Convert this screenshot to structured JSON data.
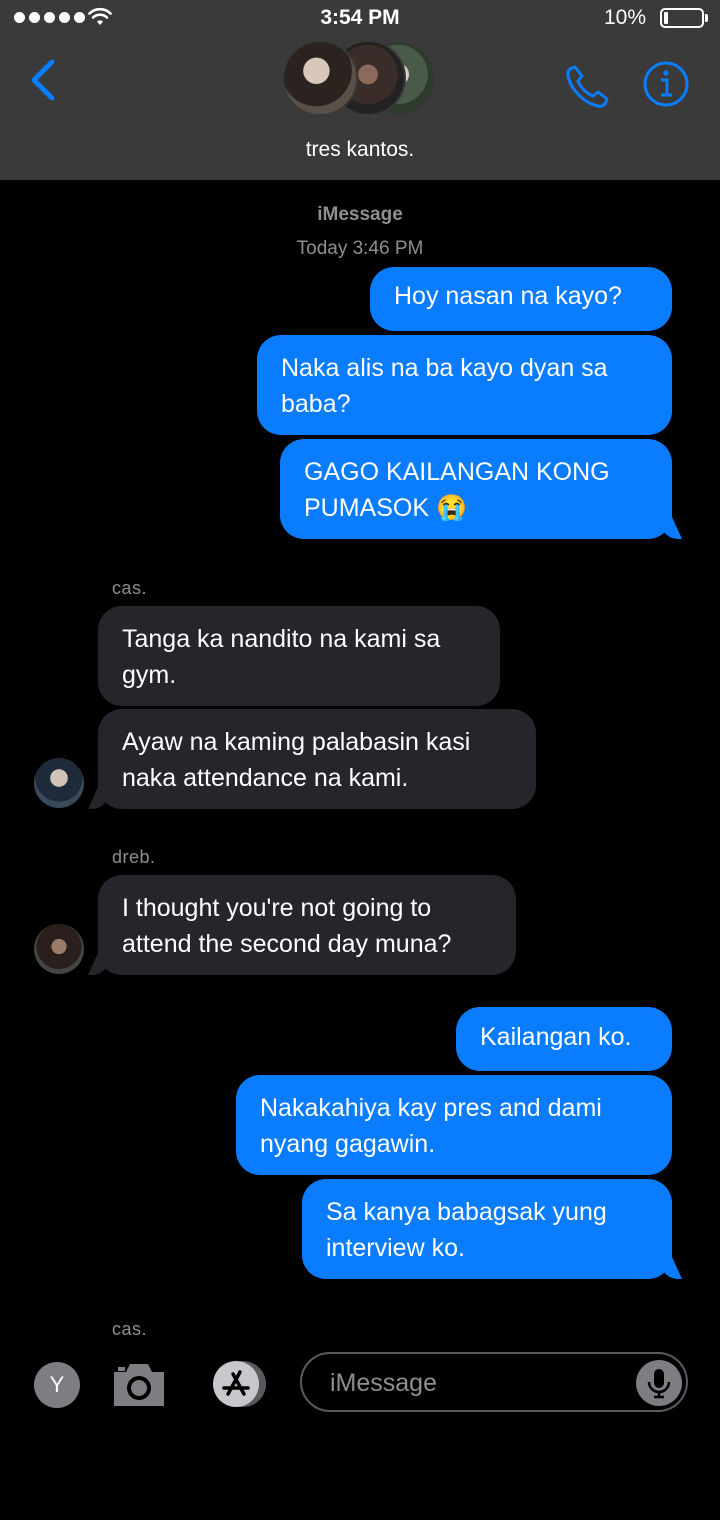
{
  "status_bar": {
    "time": "3:54 PM",
    "battery_pct": "10%",
    "battery_level": 0.1,
    "signal_dots": 5
  },
  "nav": {
    "back_icon": "chevron-left-icon",
    "group_name": "tres kantos.",
    "phone_icon": "phone-icon",
    "info_icon": "info-icon"
  },
  "thread": {
    "service": "iMessage",
    "timestamp": "Today 3:46 PM",
    "messages": [
      {
        "from": "me",
        "text": "Hoy nasan na kayo?"
      },
      {
        "from": "me",
        "text": "Naka alis na ba kayo dyan sa baba?"
      },
      {
        "from": "me",
        "text": "GAGO KAILANGAN KONG PUMASOK 😭"
      },
      {
        "from": "cas.",
        "text": "Tanga ka nandito na kami sa gym."
      },
      {
        "from": "cas.",
        "text": "Ayaw na kaming palabasin kasi naka attendance na kami."
      },
      {
        "from": "dreb.",
        "text": "I thought you're not going to attend the second day muna?"
      },
      {
        "from": "me",
        "text": "Kailangan ko."
      },
      {
        "from": "me",
        "text": "Nakakahiya kay pres and dami nyang gagawin."
      },
      {
        "from": "me",
        "text": "Sa kanya babagsak yung interview ko."
      }
    ],
    "sender_labels": {
      "cas": "cas.",
      "dreb": "dreb.",
      "typing": "cas."
    }
  },
  "input_bar": {
    "memoji_label": "Y",
    "placeholder": "iMessage",
    "camera_icon": "camera-icon",
    "apps_icon": "app-store-icon",
    "mic_icon": "microphone-icon"
  },
  "colors": {
    "outgoing": "#0a7cff",
    "incoming": "#26252b",
    "accent": "#0a7cff",
    "header": "#3a3a3a"
  }
}
